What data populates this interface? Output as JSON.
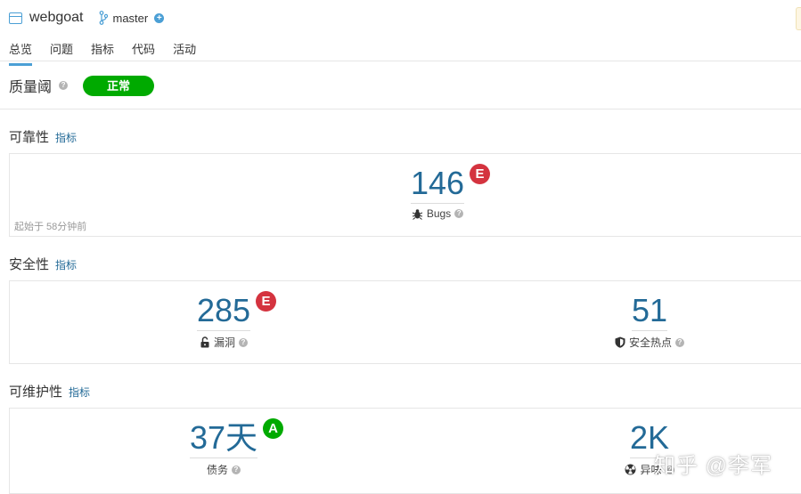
{
  "project": {
    "name": "webgoat",
    "branch": "master"
  },
  "tabs": [
    {
      "label": "总览",
      "active": true
    },
    {
      "label": "问题",
      "active": false
    },
    {
      "label": "指标",
      "active": false
    },
    {
      "label": "代码",
      "active": false
    },
    {
      "label": "活动",
      "active": false
    }
  ],
  "quality_gate": {
    "title": "质量阈",
    "status": "正常",
    "status_color": "#00aa00"
  },
  "reliability": {
    "title": "可靠性",
    "link": "指标",
    "bugs": {
      "value": "146",
      "rating": "E",
      "label": "Bugs"
    },
    "since": "起始于 58分钟前"
  },
  "security": {
    "title": "安全性",
    "link": "指标",
    "vulnerabilities": {
      "value": "285",
      "rating": "E",
      "label": "漏洞"
    },
    "hotspots": {
      "value": "51",
      "label": "安全热点"
    }
  },
  "maintainability": {
    "title": "可维护性",
    "link": "指标",
    "debt": {
      "value": "37天",
      "rating": "A",
      "label": "债务"
    },
    "smells": {
      "value": "2K",
      "label": "异味"
    }
  },
  "colors": {
    "accent": "#4b9fd5",
    "value": "#236a97",
    "rating_e": "#d4333f",
    "rating_a": "#00aa00"
  },
  "watermark": "知乎 @李军"
}
